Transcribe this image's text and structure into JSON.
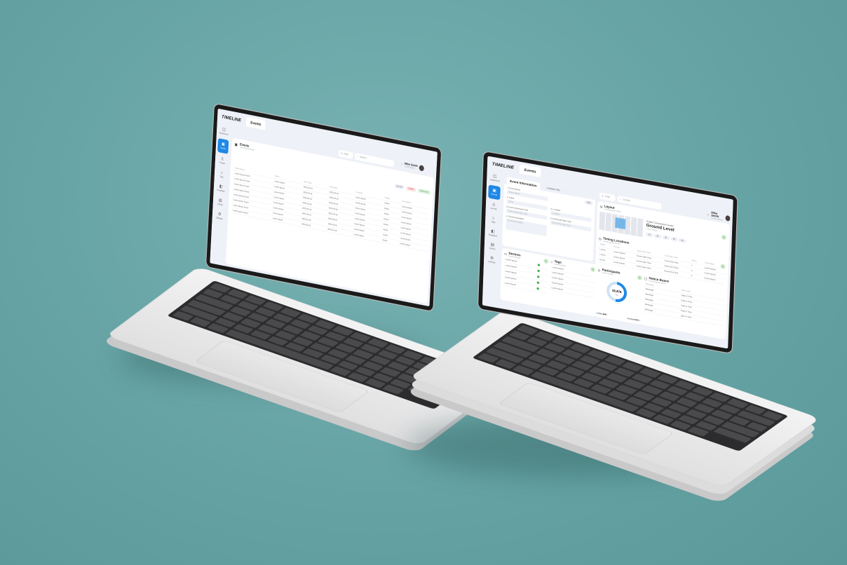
{
  "app": {
    "logo": "TIMELINE",
    "tab": "Events"
  },
  "user": {
    "name": "Mike Smith",
    "role": "Lorem Ipsum"
  },
  "topbar": {
    "filter_label": "Filter",
    "search_placeholder": "Search"
  },
  "sidebar": {
    "items": [
      {
        "label": "Dashboard",
        "icon": "dashboard-icon"
      },
      {
        "label": "Events",
        "icon": "calendar-icon"
      },
      {
        "label": "Groups",
        "icon": "group-icon"
      },
      {
        "label": "Tags",
        "icon": "tag-icon"
      },
      {
        "label": "Templates",
        "icon": "template-icon"
      },
      {
        "label": "Clients",
        "icon": "client-icon"
      },
      {
        "label": "Settings",
        "icon": "gear-icon"
      }
    ]
  },
  "left_screen": {
    "card_title": "Events",
    "card_subtitle": "Lorem Ipsum Dolor",
    "sort_label": "Sort All",
    "delete_label": "Delete",
    "add_label": "Add Event",
    "columns": [
      "Event Name",
      "Client",
      "Start Date",
      "End Date",
      "Location",
      "Status",
      "Description"
    ],
    "rows": [
      [
        "Lorem Ipsum Event",
        "Lorem Ipsum",
        "2022-04-18",
        "2022-04-19",
        "Lorem Ipsum",
        "Active",
        "Lorem Ipsum"
      ],
      [
        "Lorem Ipsum Event",
        "Lorem Ipsum",
        "2022-04-18",
        "2022-04-19",
        "Lorem Ipsum",
        "Active",
        "Lorem Ipsum"
      ],
      [
        "Lorem Ipsum Event",
        "Lorem Ipsum",
        "2022-04-18",
        "2022-04-19",
        "Lorem Ipsum",
        "Active",
        "Lorem Ipsum"
      ],
      [
        "Lorem Ipsum Event",
        "Lorem Ipsum",
        "2022-04-18",
        "2022-04-19",
        "Lorem Ipsum",
        "Active",
        "Lorem Ipsum"
      ],
      [
        "Lorem Ipsum Event",
        "Lorem Ipsum",
        "2022-04-18",
        "2022-04-19",
        "Lorem Ipsum",
        "Active",
        "Lorem Ipsum"
      ],
      [
        "Lorem Ipsum Event",
        "Lorem Ipsum",
        "2022-04-18",
        "2022-04-19",
        "Lorem Ipsum",
        "Active",
        "Lorem Ipsum"
      ],
      [
        "Lorem Ipsum Event",
        "Lorem Ipsum",
        "2022-04-18",
        "2022-04-19",
        "Lorem Ipsum",
        "Active",
        "Lorem Ipsum"
      ],
      [
        "Lorem Ipsum Event",
        "Lorem Ipsum",
        "2022-04-18",
        "2022-04-19",
        "Lorem Ipsum",
        "Active",
        "Lorem Ipsum"
      ]
    ]
  },
  "right_screen": {
    "tabs": [
      "Event Information",
      "Contact Info"
    ],
    "edit_label": "Edit",
    "fields": [
      {
        "label": "1. Event Name",
        "placeholder": "Event Name"
      },
      {
        "label": "2. Client",
        "placeholder": "Client"
      },
      {
        "label": "3. Event Start Date Time",
        "placeholder": "Event Start Date Time"
      },
      {
        "label": "4. Event Description",
        "placeholder": "Event Description"
      },
      {
        "label": "5. Location",
        "placeholder": "Location"
      },
      {
        "label": "6. Event End Date Time",
        "placeholder": "Event End Date Time"
      }
    ],
    "layout": {
      "title": "Layout",
      "subtitle": "Lorem Ipsum Dolor",
      "venue": "Sultan Convention Center",
      "level": "Ground Level",
      "level_note": "Lorem Ipsum",
      "levels": [
        "1F",
        "2F",
        "3F",
        "4F",
        "5F"
      ]
    },
    "timing": {
      "title": "Timing Locations",
      "subtitle": "Lorem Ipsum Dolor",
      "columns": [
        "Name",
        "Group",
        "Start Date Time",
        "End Date Time",
        "Order",
        "Description"
      ],
      "rows": [
        [
          "Lorem",
          "Lorem Ipsum",
          "Event Start Time",
          "Event End Time",
          "1",
          "Lorem Ipsum"
        ],
        [
          "Lorem",
          "Lorem Ipsum",
          "Event Start Time",
          "Event End Time",
          "2",
          "Lorem Ipsum"
        ],
        [
          "Lorem",
          "Lorem Ipsum",
          "Event Start Time",
          "Event End Time",
          "3",
          "Lorem Ipsum"
        ]
      ]
    },
    "devices": {
      "title": "Devices",
      "subtitle": "Lorem Ipsum",
      "rows": [
        "Lorem Ipsum",
        "Lorem Ipsum",
        "Lorem Ipsum",
        "Lorem Ipsum",
        "Lorem Ipsum"
      ]
    },
    "tags": {
      "title": "Tags",
      "subtitle": "Lorem Ipsum",
      "rows": [
        "Lorem Ipsum",
        "Lorem Ipsum",
        "Lorem Ipsum",
        "Lorem Ipsum",
        "Lorem Ipsum"
      ]
    },
    "participants": {
      "title": "Participants",
      "subtitle": "Lorem Ipsum",
      "total": "19,476",
      "total_label": "Total",
      "male_label": "Male",
      "male_value": "9997",
      "female_label": "Female",
      "female_value": "9479",
      "male_fraction": 0.513
    },
    "notice": {
      "title": "Notice Board",
      "subtitle": "Lorem Ipsum Dolor",
      "columns": [
        "Message",
        "Date Time"
      ],
      "rows": [
        [
          "Message",
          "Date & Time"
        ],
        [
          "Message",
          "Date & Time"
        ],
        [
          "Message",
          "Date & Time"
        ],
        [
          "Message",
          "Date & Time"
        ],
        [
          "Message",
          "Date & Time"
        ]
      ]
    }
  },
  "colors": {
    "accent": "#1e88e5",
    "background": "#66a3a4",
    "success": "#4caf50",
    "danger": "#ef5350"
  }
}
